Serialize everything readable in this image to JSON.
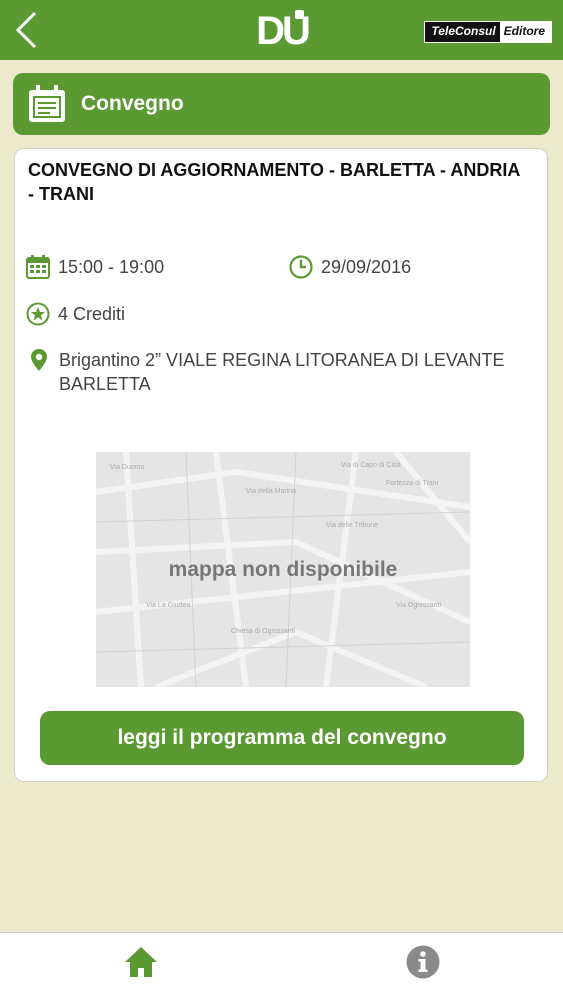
{
  "header": {
    "logo_text": "DU",
    "publisher_left": "TeleConsul",
    "publisher_right": "Editore"
  },
  "section": {
    "title": "Convegno"
  },
  "event": {
    "title": "CONVEGNO DI AGGIORNAMENTO - BARLETTA - ANDRIA - TRANI",
    "time": "15:00 - 19:00",
    "date": "29/09/2016",
    "credits": "4 Crediti",
    "address": "Brigantino 2” VIALE REGINA LITORANEA DI LEVANTE BARLETTA"
  },
  "map": {
    "unavailable_text": "mappa non disponibile"
  },
  "actions": {
    "program_button": "leggi il programma del convegno"
  },
  "colors": {
    "accent": "#5b9a33",
    "background": "#eceacd",
    "icon_gray": "#8a8a8a"
  },
  "icons": [
    "back-icon",
    "calendar-icon",
    "clock-icon",
    "star-icon",
    "location-icon",
    "home-icon",
    "info-icon"
  ]
}
